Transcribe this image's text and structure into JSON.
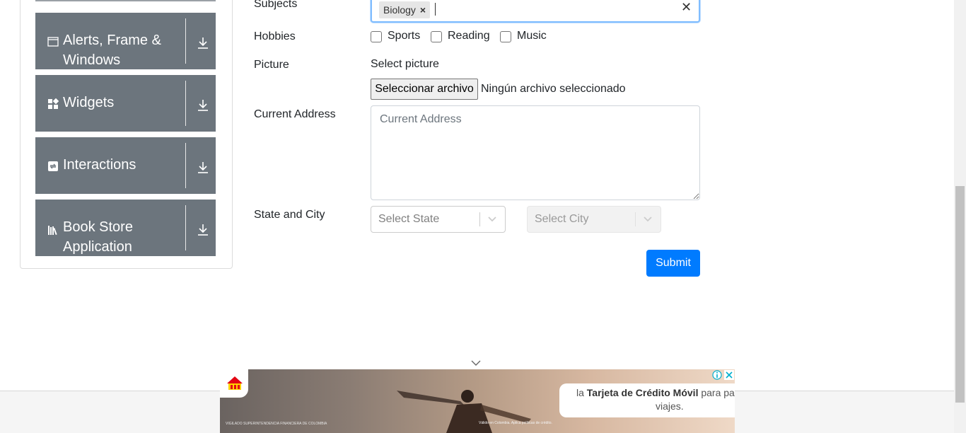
{
  "sidebar": {
    "groups": [
      {
        "title": "Alerts, Frame & Windows",
        "icon": "window-icon"
      },
      {
        "title": "Widgets",
        "icon": "widgets-icon"
      },
      {
        "title": "Interactions",
        "icon": "interactions-icon"
      },
      {
        "title": "Book Store Application",
        "icon": "books-icon"
      }
    ]
  },
  "form": {
    "subjects_label": "Subjects",
    "subjects_chip": "Biology",
    "hobbies_label": "Hobbies",
    "hobbies": [
      "Sports",
      "Reading",
      "Music"
    ],
    "picture_label": "Picture",
    "select_picture": "Select picture",
    "file_button": "Seleccionar archivo",
    "file_status": "Ningún archivo seleccionado",
    "address_label": "Current Address",
    "address_placeholder": "Current Address",
    "state_city_label": "State and City",
    "state_placeholder": "Select State",
    "city_placeholder": "Select City",
    "submit": "Submit"
  },
  "ad": {
    "bubble_prefix": "la",
    "bubble_bold": "Tarjeta de Crédito Móvil",
    "bubble_suffix": "para pag",
    "bubble_line2": "viajes.",
    "fine_print_left": "VIGILADO SUPERINTENDENCIA FINANCIERA DE COLOMBIA",
    "fine_print_center": "Válido en Colombia. Aplica políticas de crédito."
  },
  "colors": {
    "sidebar_group_bg": "#6c757d",
    "primary": "#007bff",
    "focus_border": "#80bdff"
  }
}
